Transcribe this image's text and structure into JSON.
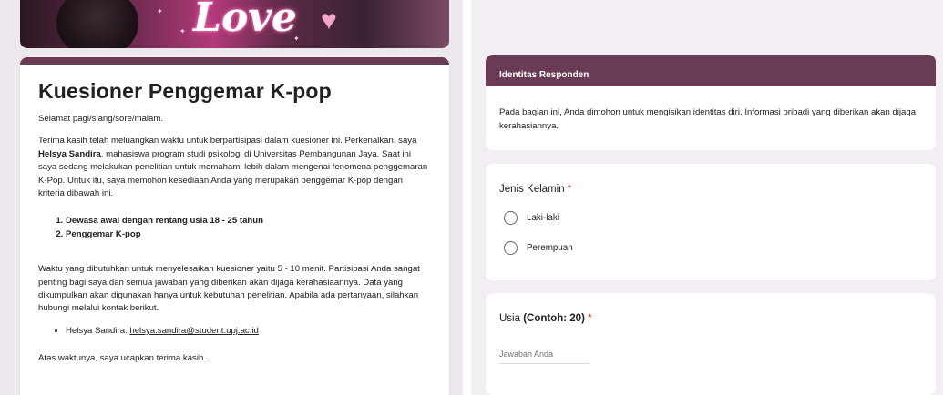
{
  "banner": {
    "text": "Love"
  },
  "form": {
    "title": "Kuesioner Penggemar K-pop",
    "greeting": "Selamat pagi/siang/sore/malam.",
    "intro_1": "Terima kasih telah meluangkan waktu untuk berpartisipasi dalam kuesioner ini. Perkenalkan, saya ",
    "intro_name": "Helsya Sandira",
    "intro_2": ", mahasiswa program studi psikologi di Universitas Pembangunan Jaya. Saat ini saya sedang melakukan penelitian untuk memahami lebih dalam mengenai fenomena penggemaran K-Pop. Untuk itu, saya memohon kesediaan Anda yang merupakan penggemar K-pop dengan kriteria dibawah ini.",
    "criteria": [
      "Dewasa awal dengan rentang usia 18 - 25 tahun",
      "Penggemar K-pop"
    ],
    "duration_text": "Waktu yang dibutuhkan untuk menyelesaikan kuesioner yaitu 5 - 10 menit. Partisipasi Anda sangat penting bagi saya dan semua jawaban yang diberikan akan dijaga kerahasiaannya. Data yang dikumpulkan akan digunakan hanya untuk kebutuhan penelitian. Apabila ada pertanyaan, silahkan hubungi melalui kontak berikut.",
    "contact_name": "Helsya Sandira: ",
    "contact_email": "helsya.sandira@student.upj.ac.id",
    "closing": "Atas waktunya, saya ucapkan terima kasih."
  },
  "section": {
    "title": "Identitas Responden",
    "description": "Pada bagian ini, Anda dimohon untuk mengisikan identitas diri. Informasi pribadi yang diberikan akan dijaga kerahasiannya."
  },
  "questions": {
    "gender": {
      "label": "Jenis Kelamin",
      "required_mark": "*",
      "options": [
        "Laki-laki",
        "Perempuan"
      ]
    },
    "age": {
      "label": "Usia ",
      "hint": "(Contoh: 20)",
      "required_mark": "*",
      "placeholder": "Jawaban Anda"
    }
  },
  "colors": {
    "theme": "#6a3b55",
    "left_background": "#ede7ee",
    "right_background": "#f2eef3",
    "required": "#d93025"
  }
}
